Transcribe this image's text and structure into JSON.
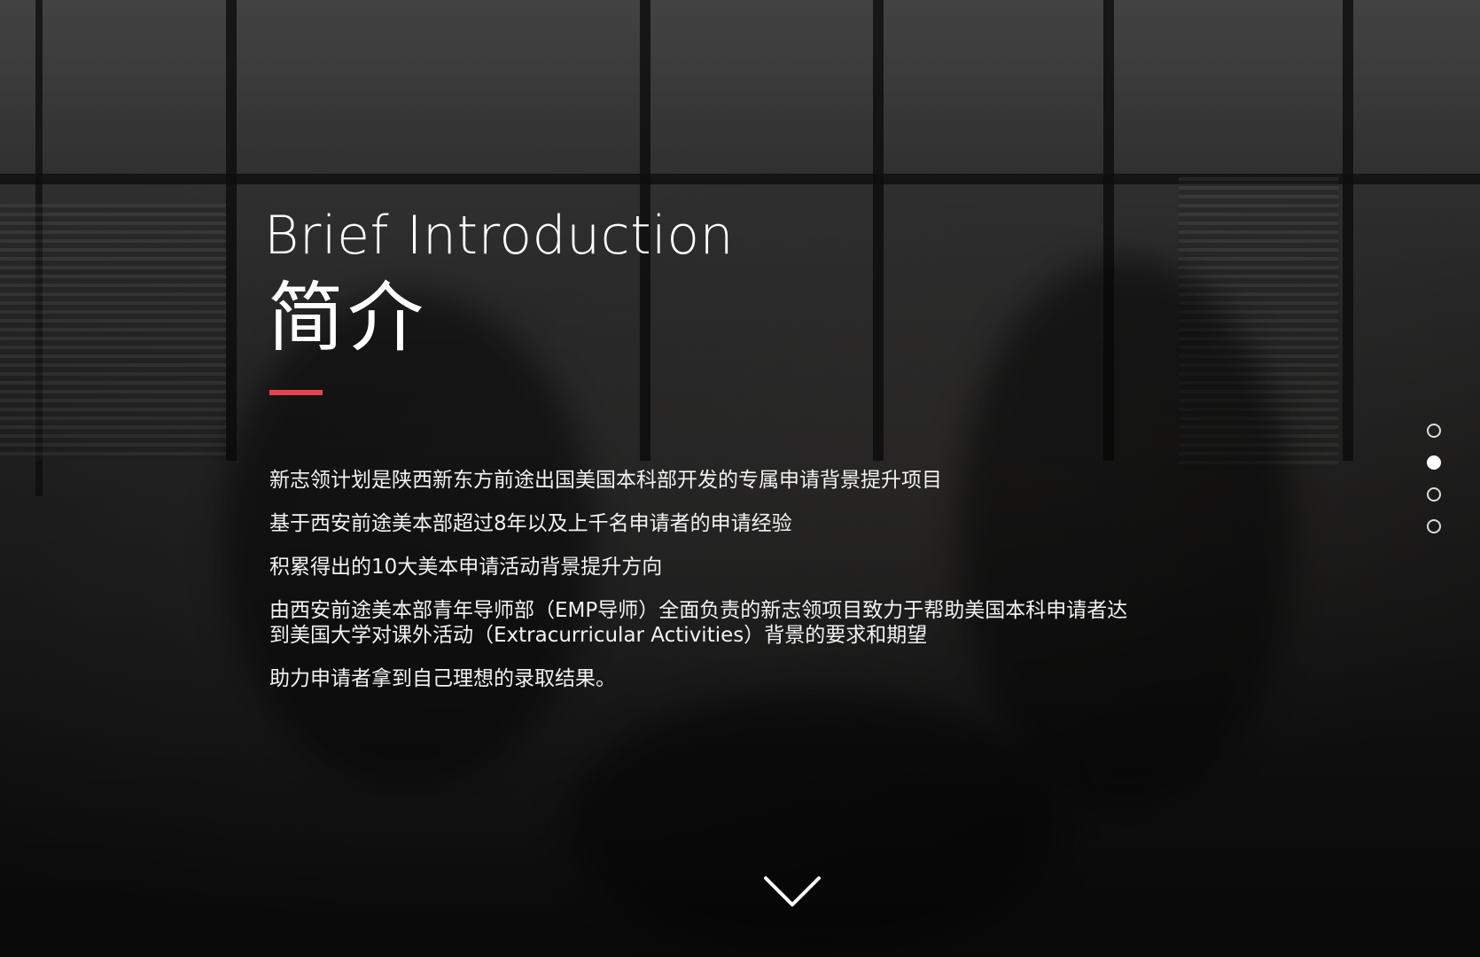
{
  "section": {
    "title_en": "Brief Introduction",
    "title_zh": "简介",
    "accent_color": "#e8414d"
  },
  "paragraphs": [
    "新志领计划是陕西新东方前途出国美国本科部开发的专属申请背景提升项目",
    "基于西安前途美本部超过8年以及上千名申请者的申请经验",
    "积累得出的10大美本申请活动背景提升方向",
    "由西安前途美本部青年导师部（EMP导师）全面负责的新志领项目致力于帮助美国本科申请者达到美国大学对课外活动（Extracurricular Activities）背景的要求和期望",
    "助力申请者拿到自己理想的录取结果。"
  ],
  "pagination": {
    "total": 4,
    "active_index": 1
  },
  "icons": {
    "scroll_down": "chevron-down-icon"
  }
}
